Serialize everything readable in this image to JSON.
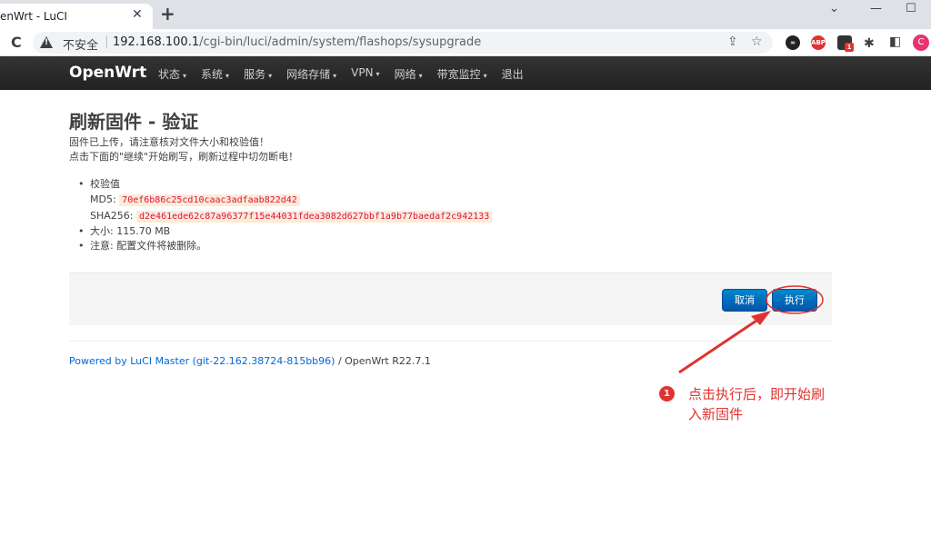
{
  "browser": {
    "tab_title": "enWrt - LuCI",
    "tab_close": "✕",
    "new_tab": "+",
    "minimize": "⌄",
    "restore": "—",
    "maximize": "☐",
    "reload": "C",
    "insecure_label": "不安全",
    "url_host": "192.168.100.1",
    "url_path": "/cgi-bin/luci/admin/system/flashops/sysupgrade",
    "ext_abp": "ABP",
    "ext_badge": "1",
    "profile_initial": "C"
  },
  "nav": {
    "brand": "OpenWrt",
    "items": [
      {
        "label": "状态",
        "caret": "▾"
      },
      {
        "label": "系统",
        "caret": "▾"
      },
      {
        "label": "服务",
        "caret": "▾"
      },
      {
        "label": "网络存储",
        "caret": "▾"
      },
      {
        "label": "VPN",
        "caret": "▾"
      },
      {
        "label": "网络",
        "caret": "▾"
      },
      {
        "label": "带宽监控",
        "caret": "▾"
      },
      {
        "label": "退出",
        "caret": ""
      }
    ]
  },
  "page": {
    "title": "刷新固件 - 验证",
    "desc1": "固件已上传，请注意核对文件大小和校验值！",
    "desc2": "点击下面的\"继续\"开始刷写，刷新过程中切勿断电！",
    "checksum_label": "校验值",
    "md5_label": "MD5:",
    "md5_value": "70ef6b86c25cd10caac3adfaab822d42",
    "sha256_label": "SHA256:",
    "sha256_value": "d2e461ede62c87a96377f15e44031fdea3082d627bbf1a9b77baedaf2c942133",
    "size_text": "大小: 115.70 MB",
    "note_text": "注意: 配置文件将被删除。",
    "cancel_label": "取消",
    "execute_label": "执行"
  },
  "footer": {
    "link_text": "Powered by LuCI Master (git-22.162.38724-815bb96)",
    "suffix": " / OpenWrt R22.7.1"
  },
  "annotation": {
    "number": "1",
    "text": "点击执行后，即开始刷入新固件",
    "color": "#e0332f"
  }
}
